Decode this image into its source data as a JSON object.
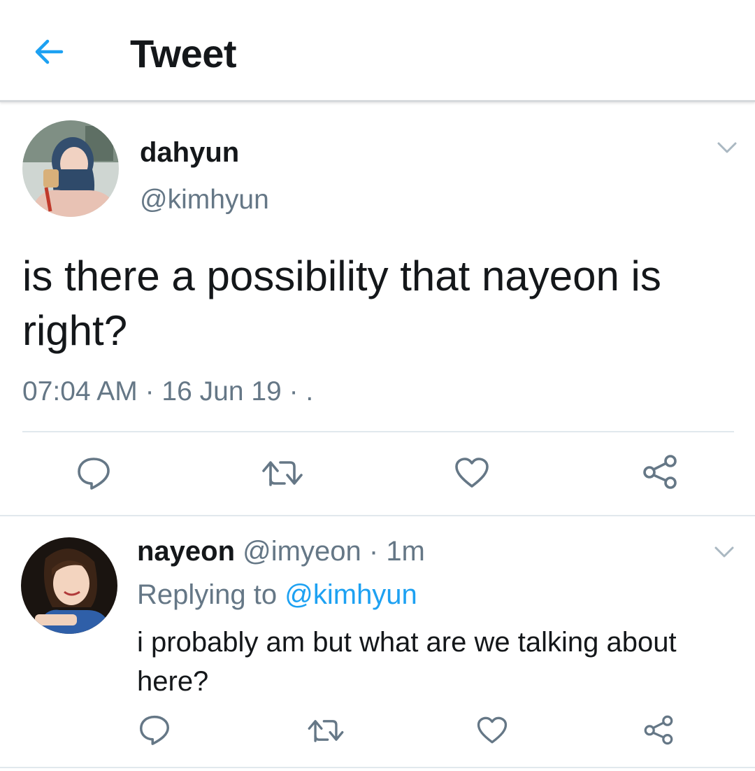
{
  "header": {
    "title": "Tweet"
  },
  "main_tweet": {
    "display_name": "dahyun",
    "handle": "@kimhyun",
    "text": "is there a possibility that nayeon is right?",
    "meta": "07:04 AM · 16 Jun 19 · ."
  },
  "reply": {
    "display_name": "nayeon",
    "handle": "@imyeon",
    "separator": "·",
    "time": "1m",
    "replying_prefix": "Replying to",
    "replying_to": "@kimhyun",
    "text": "i probably am but what are we talking about here?"
  },
  "icons": {
    "back": "arrow-left-icon",
    "more": "chevron-down-icon",
    "reply": "reply-bubble-icon",
    "retweet": "retweet-icon",
    "like": "heart-icon",
    "share": "share-icon"
  },
  "colors": {
    "accent": "#1da1f2",
    "icon_gray": "#657786",
    "text": "#14171a",
    "divider": "#e1e8ed"
  }
}
